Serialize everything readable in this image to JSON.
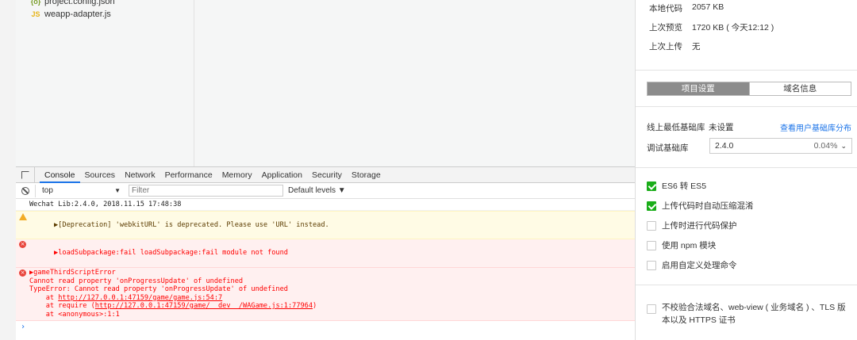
{
  "file_tree": {
    "items": [
      {
        "icon": "{o}",
        "name": "project.config.json"
      },
      {
        "icon": "JS",
        "name": "weapp-adapter.js"
      }
    ]
  },
  "devtools": {
    "tabs": [
      "Console",
      "Sources",
      "Network",
      "Performance",
      "Memory",
      "Application",
      "Security",
      "Storage"
    ],
    "active_tab": "Console",
    "context": "top",
    "filter_placeholder": "Filter",
    "levels": "Default levels ▼",
    "console": {
      "info": "Wechat Lib:2.4.0, 2018.11.15 17:48:38",
      "warn": "▶[Deprecation] 'webkitURL' is deprecated. Please use 'URL' instead.",
      "err1": "▶loadSubpackage:fail loadSubpackage:fail module not found",
      "err2": {
        "l1": "▶gameThirdScriptError",
        "l2": "Cannot read property 'onProgressUpdate' of undefined",
        "l3": "TypeError: Cannot read property 'onProgressUpdate' of undefined",
        "l4_pre": "    at ",
        "l4_link": "http://127.0.0.1:47159/game/game.js:54:7",
        "l5_pre": "    at require (",
        "l5_link": "http://127.0.0.1:47159/game/__dev__/WAGame.js:1:77964",
        "l5_post": ")",
        "l6": "    at <anonymous>:1:1"
      },
      "prompt": "›"
    }
  },
  "right_panel": {
    "info": [
      {
        "label": "本地代码",
        "value": "2057 KB"
      },
      {
        "label": "上次预览",
        "value": "1720 KB ( 今天12:12 )"
      },
      {
        "label": "上次上传",
        "value": "无"
      }
    ],
    "tabs": {
      "active": "项目设置",
      "inactive": "域名信息"
    },
    "min_lib": {
      "label": "线上最低基础库",
      "value": "未设置",
      "link": "查看用户基础库分布"
    },
    "debug_lib": {
      "label": "调试基础库",
      "value": "2.4.0",
      "percent": "0.04%"
    },
    "options": [
      {
        "label": "ES6 转 ES5",
        "checked": true
      },
      {
        "label": "上传代码时自动压缩混淆",
        "checked": true
      },
      {
        "label": "上传时进行代码保护",
        "checked": false
      },
      {
        "label": "使用 npm 模块",
        "checked": false
      },
      {
        "label": "启用自定义处理命令",
        "checked": false
      }
    ],
    "domain_option": {
      "label_l1": "不校验合法域名、web-view ( 业务域名 ) 、TLS 版",
      "label_l2": "本以及 HTTPS 证书",
      "checked": false
    },
    "colors": {
      "check": "#1aad19",
      "link": "#1a73e8",
      "error": "#ff0000",
      "warning": "#f2ab26"
    }
  }
}
